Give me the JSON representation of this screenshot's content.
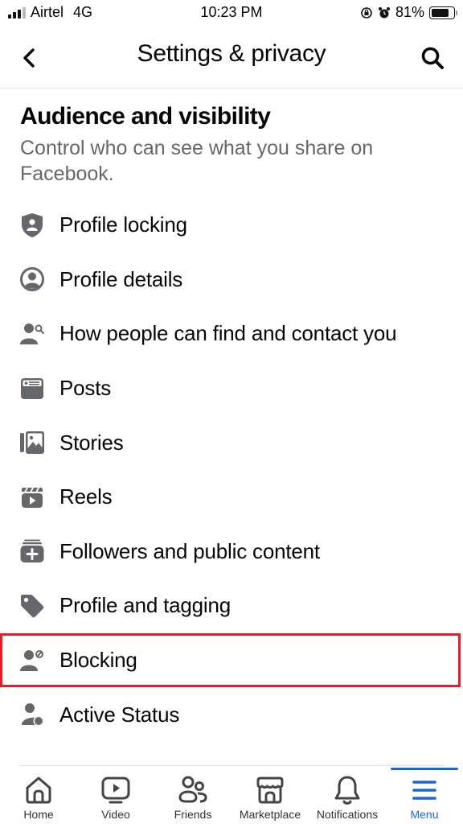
{
  "status_bar": {
    "carrier": "Airtel",
    "network": "4G",
    "time": "10:23 PM",
    "battery": "81%",
    "battery_level": 0.81
  },
  "header": {
    "title": "Settings & privacy",
    "back_icon": "chevron-left-icon",
    "search_icon": "search-icon"
  },
  "section": {
    "title": "Audience and visibility",
    "description": "Control who can see what you share on Facebook."
  },
  "items": [
    {
      "label": "Profile locking",
      "icon": "shield-person-icon"
    },
    {
      "label": "Profile details",
      "icon": "person-circle-icon"
    },
    {
      "label": "How people can find and contact you",
      "icon": "person-search-icon"
    },
    {
      "label": "Posts",
      "icon": "post-card-icon"
    },
    {
      "label": "Stories",
      "icon": "stories-icon"
    },
    {
      "label": "Reels",
      "icon": "reels-icon"
    },
    {
      "label": "Followers and public content",
      "icon": "followers-add-icon"
    },
    {
      "label": "Profile and tagging",
      "icon": "tag-icon"
    },
    {
      "label": "Blocking",
      "icon": "person-block-icon",
      "highlighted": true
    },
    {
      "label": "Active Status",
      "icon": "person-active-icon"
    }
  ],
  "highlight_color": "#e31d2a",
  "tabbar": {
    "accent_color": "#1b66d8",
    "tabs": [
      {
        "label": "Home",
        "icon": "home-icon"
      },
      {
        "label": "Video",
        "icon": "video-icon"
      },
      {
        "label": "Friends",
        "icon": "friends-icon"
      },
      {
        "label": "Marketplace",
        "icon": "marketplace-icon"
      },
      {
        "label": "Notifications",
        "icon": "bell-icon"
      },
      {
        "label": "Menu",
        "icon": "menu-icon",
        "active": true
      }
    ]
  }
}
